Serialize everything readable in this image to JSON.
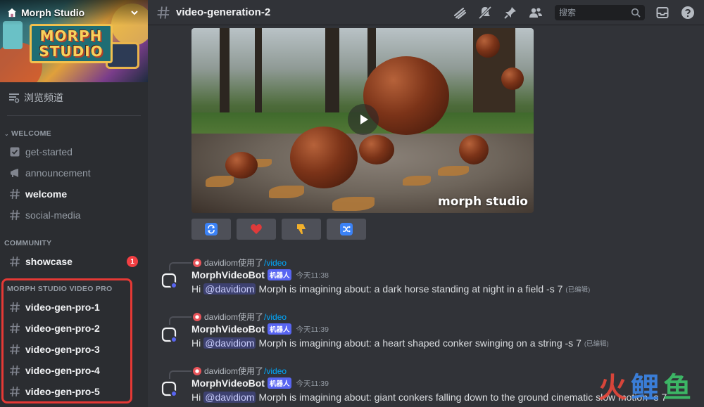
{
  "server": {
    "name": "Morph Studio",
    "banner_logo_line1": "MORPH",
    "banner_logo_line2": "STUDIO"
  },
  "sidebar": {
    "browse_label": "浏览频道",
    "categories": [
      {
        "name": "WELCOME",
        "channels": [
          {
            "label": "get-started",
            "icon": "rules-icon",
            "bright": false
          },
          {
            "label": "announcement",
            "icon": "megaphone-icon",
            "bright": false
          },
          {
            "label": "welcome",
            "icon": "hash-icon",
            "bright": true
          },
          {
            "label": "social-media",
            "icon": "hash-icon",
            "bright": false
          }
        ]
      },
      {
        "name": "COMMUNITY",
        "channels": [
          {
            "label": "showcase",
            "icon": "hash-icon",
            "bright": true,
            "badge": "1"
          }
        ]
      },
      {
        "name": "MORPH STUDIO VIDEO PRO",
        "channels": [
          {
            "label": "video-gen-pro-1",
            "icon": "hash-icon",
            "bright": true
          },
          {
            "label": "video-gen-pro-2",
            "icon": "hash-icon",
            "bright": true
          },
          {
            "label": "video-gen-pro-3",
            "icon": "hash-icon",
            "bright": true
          },
          {
            "label": "video-gen-pro-4",
            "icon": "hash-icon",
            "bright": true
          },
          {
            "label": "video-gen-pro-5",
            "icon": "hash-icon",
            "bright": true
          }
        ]
      }
    ]
  },
  "header": {
    "channel_name": "video-generation-2",
    "search_placeholder": "搜索",
    "icons": [
      "threads-icon",
      "mute-icon",
      "pin-icon",
      "members-icon",
      "inbox-icon",
      "help-icon"
    ]
  },
  "video": {
    "watermark": "morph studio",
    "buttons": [
      {
        "name": "regenerate-button",
        "color": "#3b82f6"
      },
      {
        "name": "like-button",
        "color": "#e03a3a"
      },
      {
        "name": "dislike-button",
        "color": "#f2b02b"
      },
      {
        "name": "shuffle-button",
        "color": "#3b82f6"
      }
    ]
  },
  "messages": [
    {
      "reply_user": "davidiom使用了",
      "reply_command": "/video",
      "username": "MorphVideoBot",
      "bot_tag": "机器人",
      "time": "今天11:38",
      "prefix": "Hi",
      "mention": "@davidiom",
      "text": "Morph is imagining about: a dark horse standing at night in a field -s 7",
      "edited": "(已编辑)"
    },
    {
      "reply_user": "davidiom使用了",
      "reply_command": "/video",
      "username": "MorphVideoBot",
      "bot_tag": "机器人",
      "time": "今天11:39",
      "prefix": "Hi",
      "mention": "@davidiom",
      "text": "Morph is imagining about: a heart shaped conker swinging on a string -s 7",
      "edited": "(已编辑)"
    },
    {
      "reply_user": "davidiom使用了",
      "reply_command": "/video",
      "username": "MorphVideoBot",
      "bot_tag": "机器人",
      "time": "今天11:39",
      "prefix": "Hi",
      "mention": "@davidiom",
      "text": "Morph is imagining about: giant conkers falling down to the ground cinematic slow motion -s 7",
      "edited": ""
    }
  ],
  "watermark_logo": {
    "c1": "火",
    "c2": "鲤",
    "c3": "鱼"
  }
}
